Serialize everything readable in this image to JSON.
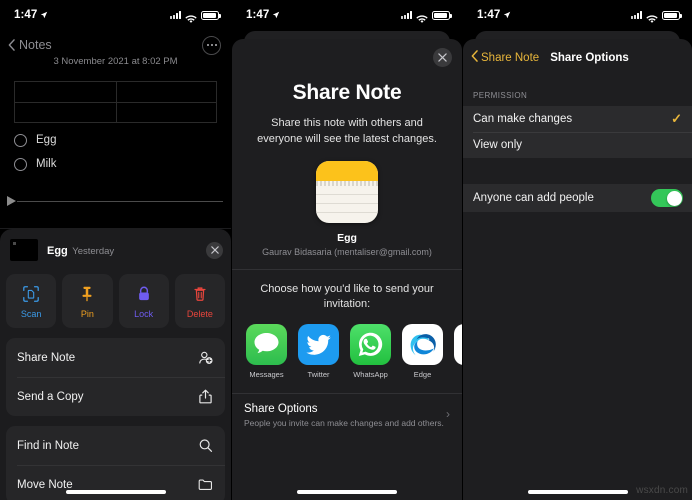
{
  "status_bar": {
    "time": "1:47",
    "location_icon": "location-arrow-icon",
    "signal_icon": "cellular-signal-icon",
    "wifi_icon": "wifi-icon",
    "battery_icon": "battery-icon"
  },
  "panel1": {
    "nav": {
      "back_label": "Notes",
      "back_icon": "chevron-left-icon",
      "more_icon": "more-circle-icon"
    },
    "note": {
      "date": "3 November 2021 at 8:02 PM",
      "table_rows": 2,
      "table_cols": 2,
      "checklist": [
        {
          "label": "Egg",
          "checked": false
        },
        {
          "label": "Milk",
          "checked": false
        }
      ]
    },
    "sheet": {
      "note_title": "Egg",
      "note_subtitle": "Yesterday",
      "close_icon": "close-icon",
      "quick_actions": [
        {
          "label": "Scan",
          "icon": "scan-document-icon",
          "color": "#3b9ae8"
        },
        {
          "label": "Pin",
          "icon": "pin-icon",
          "color": "#f0a020"
        },
        {
          "label": "Lock",
          "icon": "lock-icon",
          "color": "#6f5cf0"
        },
        {
          "label": "Delete",
          "icon": "trash-icon",
          "color": "#e8453c"
        }
      ],
      "group1": [
        {
          "label": "Share Note",
          "icon": "person-add-icon"
        },
        {
          "label": "Send a Copy",
          "icon": "share-up-icon"
        }
      ],
      "group2": [
        {
          "label": "Find in Note",
          "icon": "search-icon"
        },
        {
          "label": "Move Note",
          "icon": "folder-icon"
        }
      ]
    }
  },
  "panel2": {
    "close_icon": "close-icon",
    "heading": "Share Note",
    "description": "Share this note with others and everyone will see the latest changes.",
    "note_icon": "notes-app-icon",
    "note_name": "Egg",
    "note_owner": "Gaurav Bidasaria (mentaliser@gmail.com)",
    "choose_text": "Choose how you'd like to send your invitation:",
    "apps": [
      {
        "label": "Messages",
        "icon": "messages-app-icon"
      },
      {
        "label": "Twitter",
        "icon": "twitter-app-icon"
      },
      {
        "label": "WhatsApp",
        "icon": "whatsapp-app-icon"
      },
      {
        "label": "Edge",
        "icon": "edge-app-icon"
      },
      {
        "label": "",
        "icon": "flickr-app-icon"
      }
    ],
    "share_options": {
      "title": "Share Options",
      "subtitle": "People you invite can make changes and add others.",
      "chevron": "›"
    }
  },
  "panel3": {
    "back_label": "Share Note",
    "back_icon": "chevron-left-icon",
    "title": "Share Options",
    "section_header": "PERMISSION",
    "permissions": [
      {
        "label": "Can make changes",
        "selected": true,
        "check": "✓"
      },
      {
        "label": "View only",
        "selected": false,
        "check": ""
      }
    ],
    "toggle": {
      "label": "Anyone can add people",
      "on": true
    }
  },
  "watermark": "wsxdn.com",
  "colors": {
    "accent_yellow": "#e8b63b",
    "toggle_green": "#34c759",
    "sheet_bg": "#1c1c1e"
  }
}
